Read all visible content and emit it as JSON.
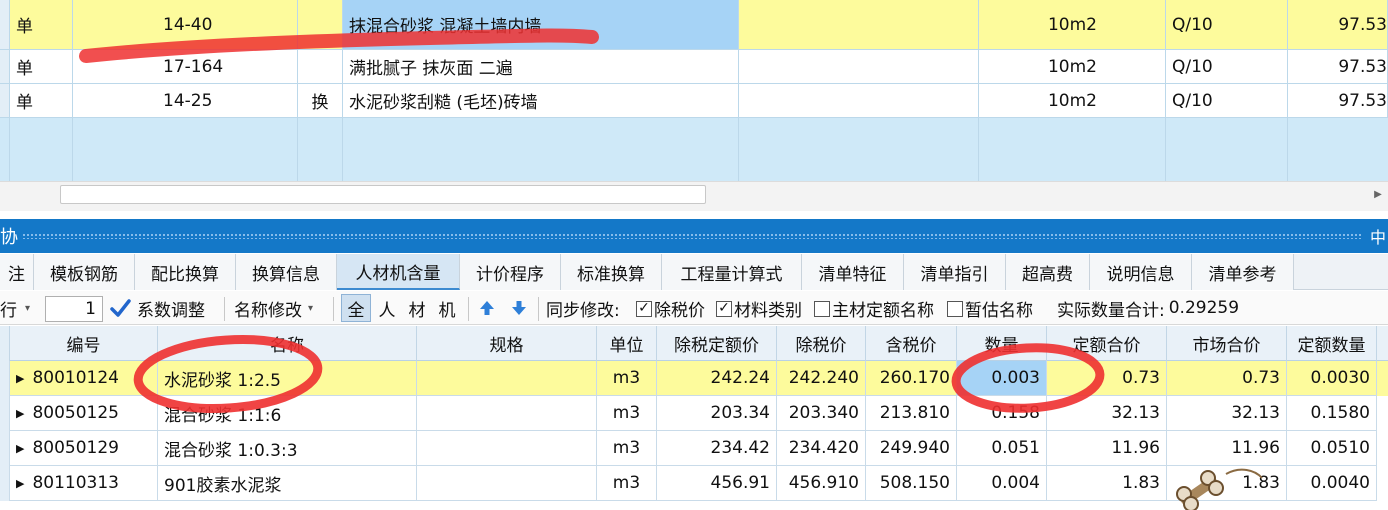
{
  "top_table": {
    "rows": [
      {
        "type": "单",
        "code": "14-40",
        "flag": "",
        "name": "抹混合砂浆 混凝土墙内墙",
        "unit": "10m2",
        "qty_expr": "Q/10",
        "qty": "97.53"
      },
      {
        "type": "单",
        "code": "17-164",
        "flag": "",
        "name": "满批腻子 抹灰面 二遍",
        "unit": "10m2",
        "qty_expr": "Q/10",
        "qty": "97.53"
      },
      {
        "type": "单",
        "code": "14-25",
        "flag": "换",
        "name": "水泥砂浆刮糙 (毛坯)砖墙",
        "unit": "10m2",
        "qty_expr": "Q/10",
        "qty": "97.53"
      }
    ]
  },
  "panel": {
    "title_fragment": "协",
    "pin_glyph": "中"
  },
  "tabs": [
    "注",
    "模板钢筋",
    "配比换算",
    "换算信息",
    "人材机含量",
    "计价程序",
    "标准换算",
    "工程量计算式",
    "清单特征",
    "清单指引",
    "超高费",
    "说明信息",
    "清单参考"
  ],
  "active_tab": "人材机含量",
  "toolbar": {
    "row_label": "行",
    "spin_value": "1",
    "coef_adjust": "系数调整",
    "name_modify": "名称修改",
    "filters": [
      "全",
      "人",
      "材",
      "机"
    ],
    "sync_label": "同步修改:",
    "opt_pretax": "除税价",
    "opt_category": "材料类别",
    "opt_main_name": "主材定额名称",
    "opt_est_name": "暂估名称",
    "actual_total_label": "实际数量合计:",
    "actual_total_value": "0.29259"
  },
  "bottom_table": {
    "headers": [
      "编号",
      "名称",
      "规格",
      "单位",
      "除税定额价",
      "除税价",
      "含税价",
      "数量",
      "定额合价",
      "市场合价",
      "定额数量"
    ],
    "rows": [
      {
        "code": "80010124",
        "name": "水泥砂浆 1:2.5",
        "spec": "",
        "unit": "m3",
        "base_price": "242.24",
        "pretax": "242.240",
        "taxed": "260.170",
        "qty": "0.003",
        "quota_total": "0.73",
        "market_total": "0.73",
        "quota_qty": "0.0030"
      },
      {
        "code": "80050125",
        "name": "混合砂浆 1:1:6",
        "spec": "",
        "unit": "m3",
        "base_price": "203.34",
        "pretax": "203.340",
        "taxed": "213.810",
        "qty": "0.158",
        "quota_total": "32.13",
        "market_total": "32.13",
        "quota_qty": "0.1580"
      },
      {
        "code": "80050129",
        "name": "混合砂浆 1:0.3:3",
        "spec": "",
        "unit": "m3",
        "base_price": "234.42",
        "pretax": "234.420",
        "taxed": "249.940",
        "qty": "0.051",
        "quota_total": "11.96",
        "market_total": "11.96",
        "quota_qty": "0.0510"
      },
      {
        "code": "80110313",
        "name": "901胶素水泥浆",
        "spec": "",
        "unit": "m3",
        "base_price": "456.91",
        "pretax": "456.910",
        "taxed": "508.150",
        "qty": "0.004",
        "quota_total": "1.83",
        "market_total": "1.83",
        "quota_qty": "0.0040"
      }
    ]
  },
  "colors": {
    "selected_row": "#fdfb9c",
    "selected_cell": "#a6d3f6",
    "panel_header": "#1478c8",
    "annotation": "#ee3030"
  }
}
